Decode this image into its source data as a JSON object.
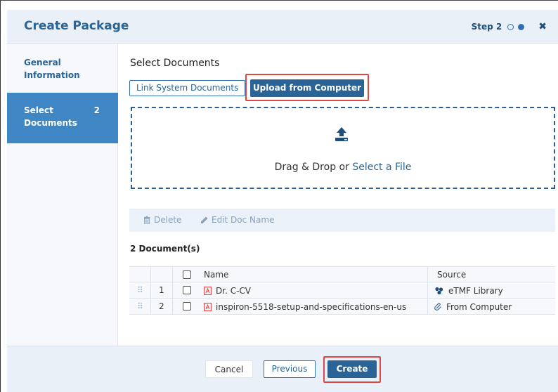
{
  "dialog": {
    "title": "Create Package",
    "step_label": "Step 2",
    "close_icon": "close-icon"
  },
  "sidebar": {
    "items": [
      {
        "label": "General Information",
        "count": ""
      },
      {
        "label": "Select Documents",
        "count": "2"
      }
    ]
  },
  "main": {
    "section_title": "Select Documents",
    "tabs": [
      {
        "label": "Link System Documents"
      },
      {
        "label": "Upload from Computer"
      }
    ],
    "dropzone": {
      "text": "Drag & Drop or ",
      "link": "Select a File",
      "icon": "upload-icon"
    },
    "toolbar": {
      "delete_label": "Delete",
      "edit_label": "Edit Doc Name"
    },
    "doc_count": "2 Document(s)",
    "table": {
      "columns": [
        "Name",
        "Source"
      ],
      "rows": [
        {
          "num": "1",
          "name": "Dr. C-CV",
          "source": "eTMF Library"
        },
        {
          "num": "2",
          "name": "inspiron-5518-setup-and-specifications-en-us",
          "source": "From Computer"
        }
      ]
    }
  },
  "footer": {
    "cancel": "Cancel",
    "previous": "Previous",
    "create": "Create"
  },
  "colors": {
    "accent": "#2a6496",
    "highlight": "#e04646",
    "sidebar_active": "#3e87c4"
  }
}
